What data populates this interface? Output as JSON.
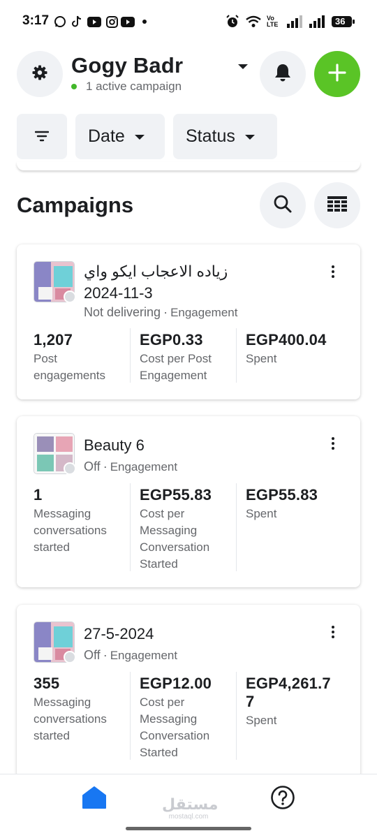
{
  "status_bar": {
    "time": "3:17",
    "network_label": "Vo LTE",
    "battery_level": "36"
  },
  "header": {
    "account_name": "Gogy Badr",
    "active_label": "1 active campaign",
    "accent_color": "#5ac426"
  },
  "filters": {
    "date_label": "Date",
    "status_label": "Status"
  },
  "section": {
    "title": "Campaigns"
  },
  "campaigns": [
    {
      "name": "زياده الاعجاب ايكو واي",
      "name_line2": "2024-11-3",
      "status": "Not delivering",
      "objective": "Engagement",
      "metrics": [
        {
          "value": "1,207",
          "label_lines": [
            "Post",
            "engagements"
          ]
        },
        {
          "value": "EGP0.33",
          "label_lines": [
            "Cost per Post",
            "Engagement"
          ]
        },
        {
          "value": "EGP400.04",
          "label_lines": [
            "Spent"
          ]
        }
      ]
    },
    {
      "name": "Beauty 6",
      "status": "Off",
      "objective": "Engagement",
      "metrics": [
        {
          "value": "1",
          "label_lines": [
            "Messaging",
            "conversations",
            "started"
          ]
        },
        {
          "value": "EGP55.83",
          "label_lines": [
            "Cost per",
            "Messaging",
            "Conversation",
            "Started"
          ]
        },
        {
          "value": "EGP55.83",
          "label_lines": [
            "Spent"
          ]
        }
      ]
    },
    {
      "name": "27-5-2024",
      "status": "Off",
      "objective": "Engagement",
      "metrics": [
        {
          "value": "355",
          "label_lines": [
            "Messaging",
            "conversations",
            "started"
          ]
        },
        {
          "value": "EGP12.00",
          "label_lines": [
            "Cost per",
            "Messaging",
            "Conversation",
            "Started"
          ]
        },
        {
          "value_lines": [
            "EGP4,261.7",
            "7"
          ],
          "label_lines": [
            "Spent"
          ]
        }
      ]
    }
  ],
  "watermark": {
    "arabic": "مستقل",
    "latin": "mostaql.com"
  }
}
